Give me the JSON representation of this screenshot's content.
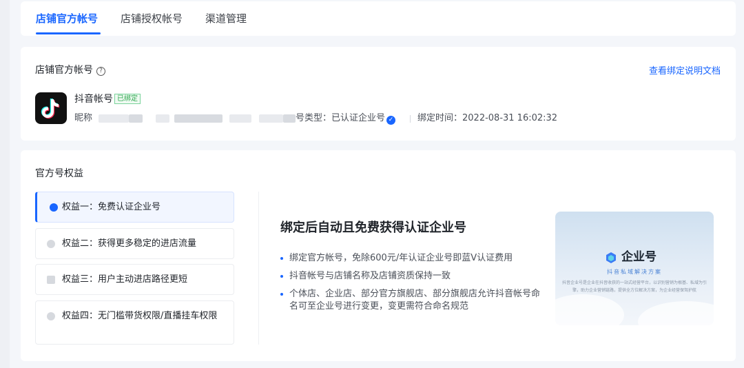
{
  "tabs": [
    {
      "label": "店铺官方帐号",
      "active": true
    },
    {
      "label": "店铺授权帐号",
      "active": false
    },
    {
      "label": "渠道管理",
      "active": false
    }
  ],
  "account": {
    "section_title": "店铺官方帐号",
    "help_icon": "?",
    "doc_link": "查看绑定说明文档",
    "platform_name": "抖音帐号",
    "bound_badge": "已绑定",
    "nickname_label": "昵称",
    "account_type": "号类型：已认证企业号",
    "verified_mark": "✓",
    "bind_time": "绑定时间：2022-08-31 16:02:32"
  },
  "benefits": {
    "section_title": "官方号权益",
    "items": [
      {
        "label": "权益一：免费认证企业号",
        "active": true
      },
      {
        "label": "权益二：获得更多稳定的进店流量",
        "active": false
      },
      {
        "label": "权益三：用户主动进店路径更短",
        "active": false
      },
      {
        "label": "权益四：无门槛带货权限/直播挂车权限",
        "active": false
      }
    ],
    "detail_title": "绑定后自动且免费获得认证企业号",
    "detail_bullets": [
      "绑定官方帐号，免除600元/年认证企业号即蓝V认证费用",
      "抖音帐号与店铺名称及店铺资质保持一致",
      "个体店、企业店、部分官方旗舰店、部分旗舰店允许抖音帐号命名可至企业号进行变更，变更需符合命名规范"
    ],
    "promo": {
      "title": "企业号",
      "subtitle": "抖音私域解决方案",
      "description": "抖音企业号是企业在抖音收获的一站式经营平台，以识别营销为根基、私域为引擎，助力企业营销链路，提供全方位解决方案，为企业经营保驾护航"
    }
  },
  "colors": {
    "accent": "#1966ff",
    "badge_green": "#2fa84f",
    "background": "#f4f6fa"
  }
}
